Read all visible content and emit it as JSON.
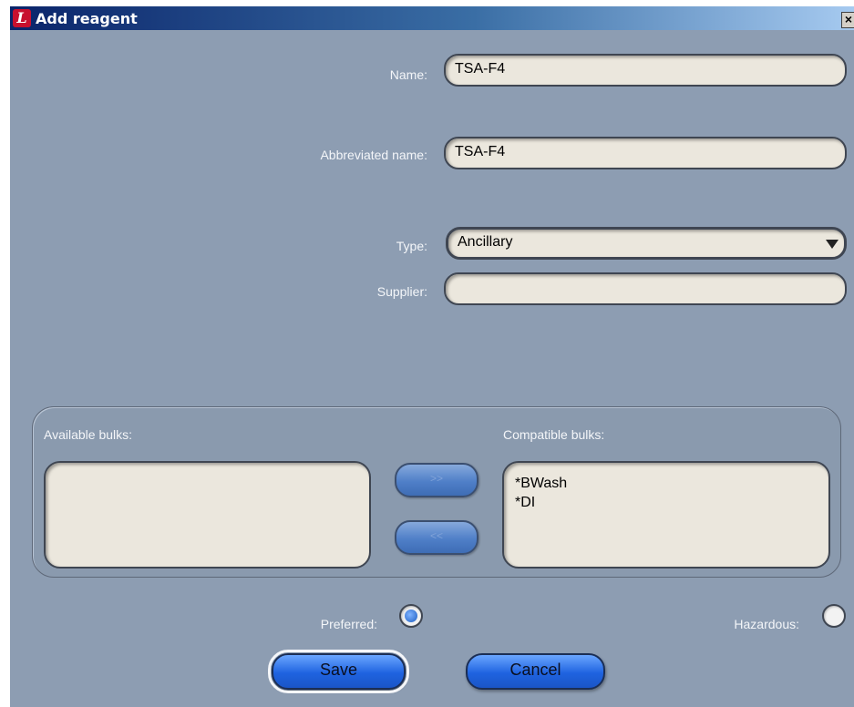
{
  "window": {
    "title": "Add reagent",
    "app_icon": "leica-logo-icon",
    "close_icon": "close-icon"
  },
  "form": {
    "name_label": "Name:",
    "name_value": "TSA-F4",
    "abbreviated_label": "Abbreviated name:",
    "abbreviated_value": "TSA-F4",
    "type_label": "Type:",
    "type_value": "Ancillary",
    "supplier_label": "Supplier:",
    "supplier_value": ""
  },
  "bulks": {
    "available_label": "Available bulks:",
    "available_items": [],
    "compatible_label": "Compatible bulks:",
    "compatible_items": [
      "*BWash",
      "*DI"
    ],
    "add_label": ">>",
    "remove_label": "<<"
  },
  "options": {
    "preferred_label": "Preferred:",
    "preferred_checked": true,
    "hazardous_label": "Hazardous:",
    "hazardous_checked": false
  },
  "buttons": {
    "save": "Save",
    "cancel": "Cancel"
  },
  "colors": {
    "dialog_bg": "#8d9db2",
    "field_bg": "#ebe7dd",
    "button_blue": "#1f63e0"
  }
}
